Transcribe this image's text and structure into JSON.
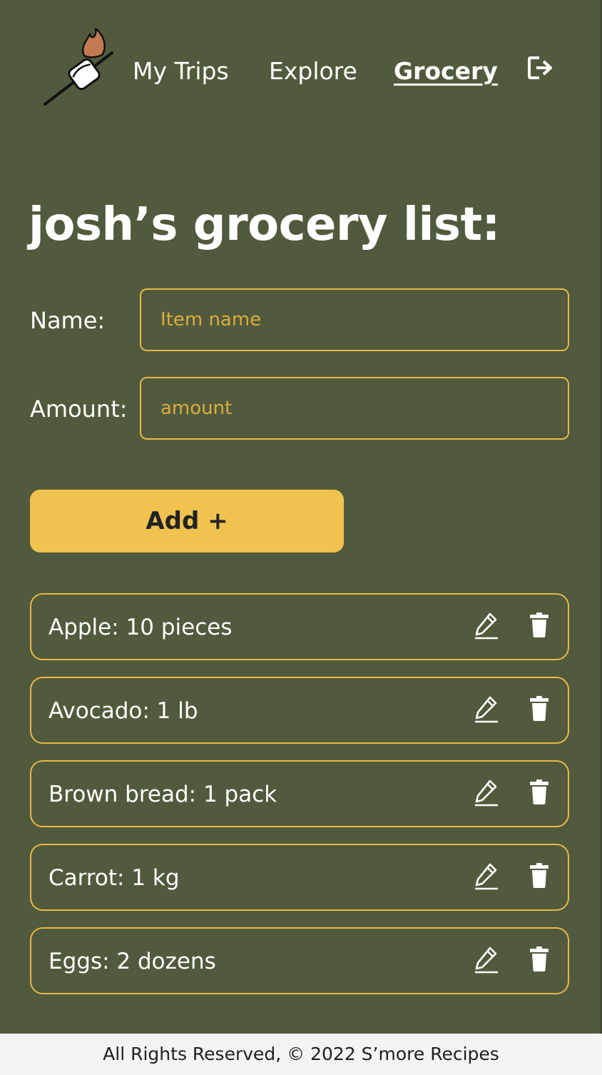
{
  "nav": {
    "logo_icon": "marshmallow-on-stick-icon",
    "links": [
      {
        "label": "My Trips"
      },
      {
        "label": "Explore"
      },
      {
        "label": "Grocery",
        "active": true
      }
    ],
    "logout_icon": "logout-icon"
  },
  "page": {
    "title": "josh’s grocery list:"
  },
  "form": {
    "name_label": "Name:",
    "name_placeholder": "Item name",
    "name_value": "",
    "amount_label": "Amount:",
    "amount_placeholder": "amount",
    "amount_value": "",
    "add_label": "Add +"
  },
  "items": [
    {
      "text": "Apple: 10 pieces"
    },
    {
      "text": "Avocado: 1 lb"
    },
    {
      "text": "Brown bread: 1 pack"
    },
    {
      "text": "Carrot: 1 kg"
    },
    {
      "text": "Eggs: 2 dozens"
    }
  ],
  "item_icons": {
    "edit": "pencil-icon",
    "delete": "trash-icon"
  },
  "footer": {
    "text": "All Rights Reserved, © 2022 S’more Recipes"
  },
  "colors": {
    "background": "#525a3d",
    "accent": "#f0c24f",
    "border": "#e6b948",
    "text": "#ffffff",
    "footer_bg": "#f4f4f2"
  }
}
